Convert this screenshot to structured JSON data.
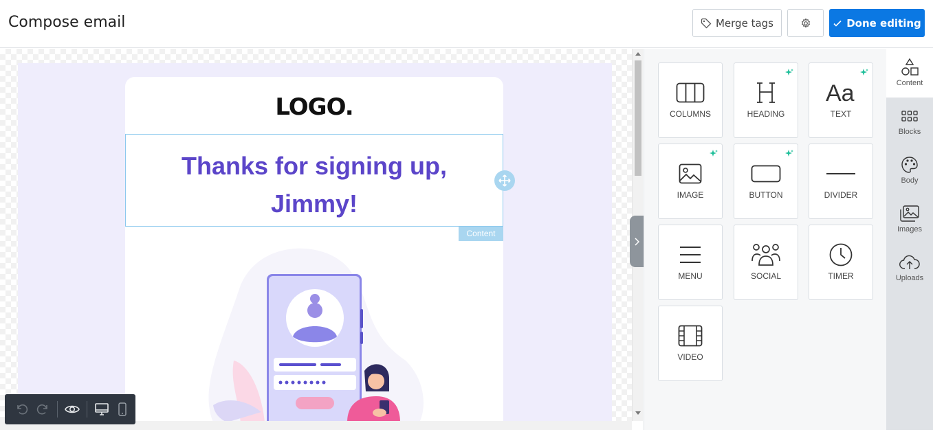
{
  "header": {
    "title": "Compose email",
    "merge_tags_label": "Merge tags",
    "done_label": "Done editing"
  },
  "email": {
    "logo_text": "LOGO.",
    "headline_line1": "Thanks for signing up,",
    "headline_line2": "Jimmy!",
    "content_tag": "Content"
  },
  "tools": [
    {
      "label": "COLUMNS",
      "icon": "columns-icon",
      "ai": false
    },
    {
      "label": "HEADING",
      "icon": "heading-icon",
      "ai": true
    },
    {
      "label": "TEXT",
      "icon": "text-icon",
      "ai": true
    },
    {
      "label": "IMAGE",
      "icon": "image-icon",
      "ai": true
    },
    {
      "label": "BUTTON",
      "icon": "button-icon",
      "ai": true
    },
    {
      "label": "DIVIDER",
      "icon": "divider-icon",
      "ai": false
    },
    {
      "label": "MENU",
      "icon": "menu-icon",
      "ai": false
    },
    {
      "label": "SOCIAL",
      "icon": "social-icon",
      "ai": false
    },
    {
      "label": "TIMER",
      "icon": "timer-icon",
      "ai": false
    },
    {
      "label": "VIDEO",
      "icon": "video-icon",
      "ai": false
    }
  ],
  "sidebar": {
    "items": [
      {
        "label": "Content",
        "icon": "shapes-icon",
        "active": true
      },
      {
        "label": "Blocks",
        "icon": "grid-icon",
        "active": false
      },
      {
        "label": "Body",
        "icon": "palette-icon",
        "active": false
      },
      {
        "label": "Images",
        "icon": "images-icon",
        "active": false
      },
      {
        "label": "Uploads",
        "icon": "cloud-upload-icon",
        "active": false
      }
    ]
  },
  "colors": {
    "accent": "#0b78e3",
    "headline": "#5b45c9",
    "email_background": "#efedfc",
    "ai_sparkle": "#1fbf9a"
  }
}
